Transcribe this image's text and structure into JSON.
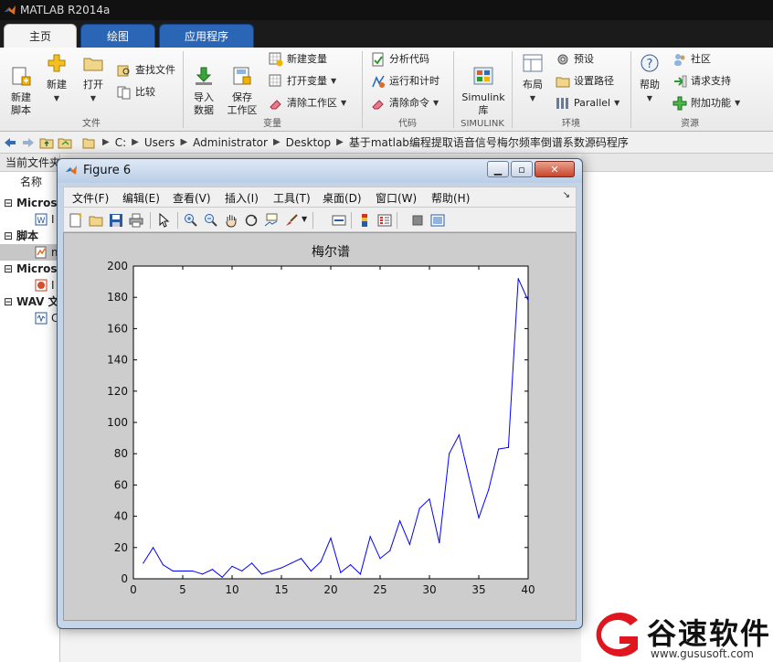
{
  "app": {
    "title": "MATLAB R2014a"
  },
  "tabs": [
    {
      "label": "主页",
      "active": true
    },
    {
      "label": "绘图",
      "active": false
    },
    {
      "label": "应用程序",
      "active": false
    }
  ],
  "ribbon": {
    "file": {
      "new_script": "新建\n脚本",
      "new": "新建",
      "open": "打开",
      "find_files": "查找文件",
      "compare": "比较",
      "group_label": "文件"
    },
    "variable": {
      "import_data": "导入\n数据",
      "save_workspace": "保存\n工作区",
      "new_variable": "新建变量",
      "open_variable": "打开变量",
      "clear_workspace": "清除工作区",
      "group_label": "变量"
    },
    "code": {
      "analyze_code": "分析代码",
      "run_and_time": "运行和计时",
      "clear_commands": "清除命令",
      "group_label": "代码"
    },
    "simulink": {
      "library": "Simulink\n库",
      "group_label": "SIMULINK"
    },
    "environment": {
      "layout": "布局",
      "preferences": "预设",
      "set_path": "设置路径",
      "parallel": "Parallel",
      "group_label": "环境"
    },
    "resources": {
      "help": "帮助",
      "community": "社区",
      "request_support": "请求支持",
      "add_ons": "附加功能",
      "group_label": "资源"
    }
  },
  "address": {
    "crumbs": [
      "C:",
      "Users",
      "Administrator",
      "Desktop",
      "基于matlab编程提取语音信号梅尔频率倒谱系数源码程序"
    ]
  },
  "left_panel": {
    "title": "当前文件夹",
    "name_header": "名称",
    "groups": [
      {
        "label": "Micros",
        "item": "I"
      },
      {
        "label": "脚本",
        "item": "m"
      },
      {
        "label": "Micros",
        "item": "I"
      },
      {
        "label": "WAV 文",
        "item": "C"
      }
    ]
  },
  "figure": {
    "title": "Figure 6",
    "menus": [
      "文件(F)",
      "编辑(E)",
      "查看(V)",
      "插入(I)",
      "工具(T)",
      "桌面(D)",
      "窗口(W)",
      "帮助(H)"
    ],
    "toolbar_icons": [
      "new-figure-icon",
      "open-file-icon",
      "save-icon",
      "print-icon",
      "pointer-icon",
      "zoom-in-icon",
      "zoom-out-icon",
      "pan-hand-icon",
      "rotate-3d-icon",
      "data-cursor-icon",
      "brush-icon",
      "link-plot-icon",
      "colorbar-icon",
      "legend-icon",
      "hide-plot-tools-icon",
      "show-plot-tools-icon"
    ]
  },
  "chart_data": {
    "type": "line",
    "title": "梅尔谱",
    "xlabel": "",
    "ylabel": "",
    "xlim": [
      0,
      40
    ],
    "ylim": [
      0,
      200
    ],
    "xticks": [
      0,
      5,
      10,
      15,
      20,
      25,
      30,
      35,
      40
    ],
    "yticks": [
      0,
      20,
      40,
      60,
      80,
      100,
      120,
      140,
      160,
      180,
      200
    ],
    "line_color": "#0000ff",
    "series": [
      {
        "x": [
          1,
          2,
          3,
          4,
          5,
          6,
          7,
          8,
          9,
          10,
          11,
          12,
          13,
          14,
          15,
          16,
          17,
          18,
          19,
          20,
          21,
          22,
          23,
          24,
          25,
          26,
          27,
          28,
          29,
          30,
          31,
          32,
          33,
          34,
          35,
          36,
          37,
          38,
          39,
          40
        ],
        "values": [
          10,
          20,
          9,
          5,
          5,
          5,
          3,
          6,
          1,
          8,
          5,
          10,
          3,
          5,
          7,
          10,
          13,
          5,
          11,
          26,
          4,
          9,
          3,
          27,
          13,
          18,
          37,
          22,
          45,
          51,
          23,
          80,
          92,
          65,
          39,
          57,
          83,
          84,
          192,
          178
        ]
      }
    ]
  },
  "watermark": {
    "brand": "谷速软件",
    "url": "www.gususoft.com",
    "color": "#e0161e"
  }
}
